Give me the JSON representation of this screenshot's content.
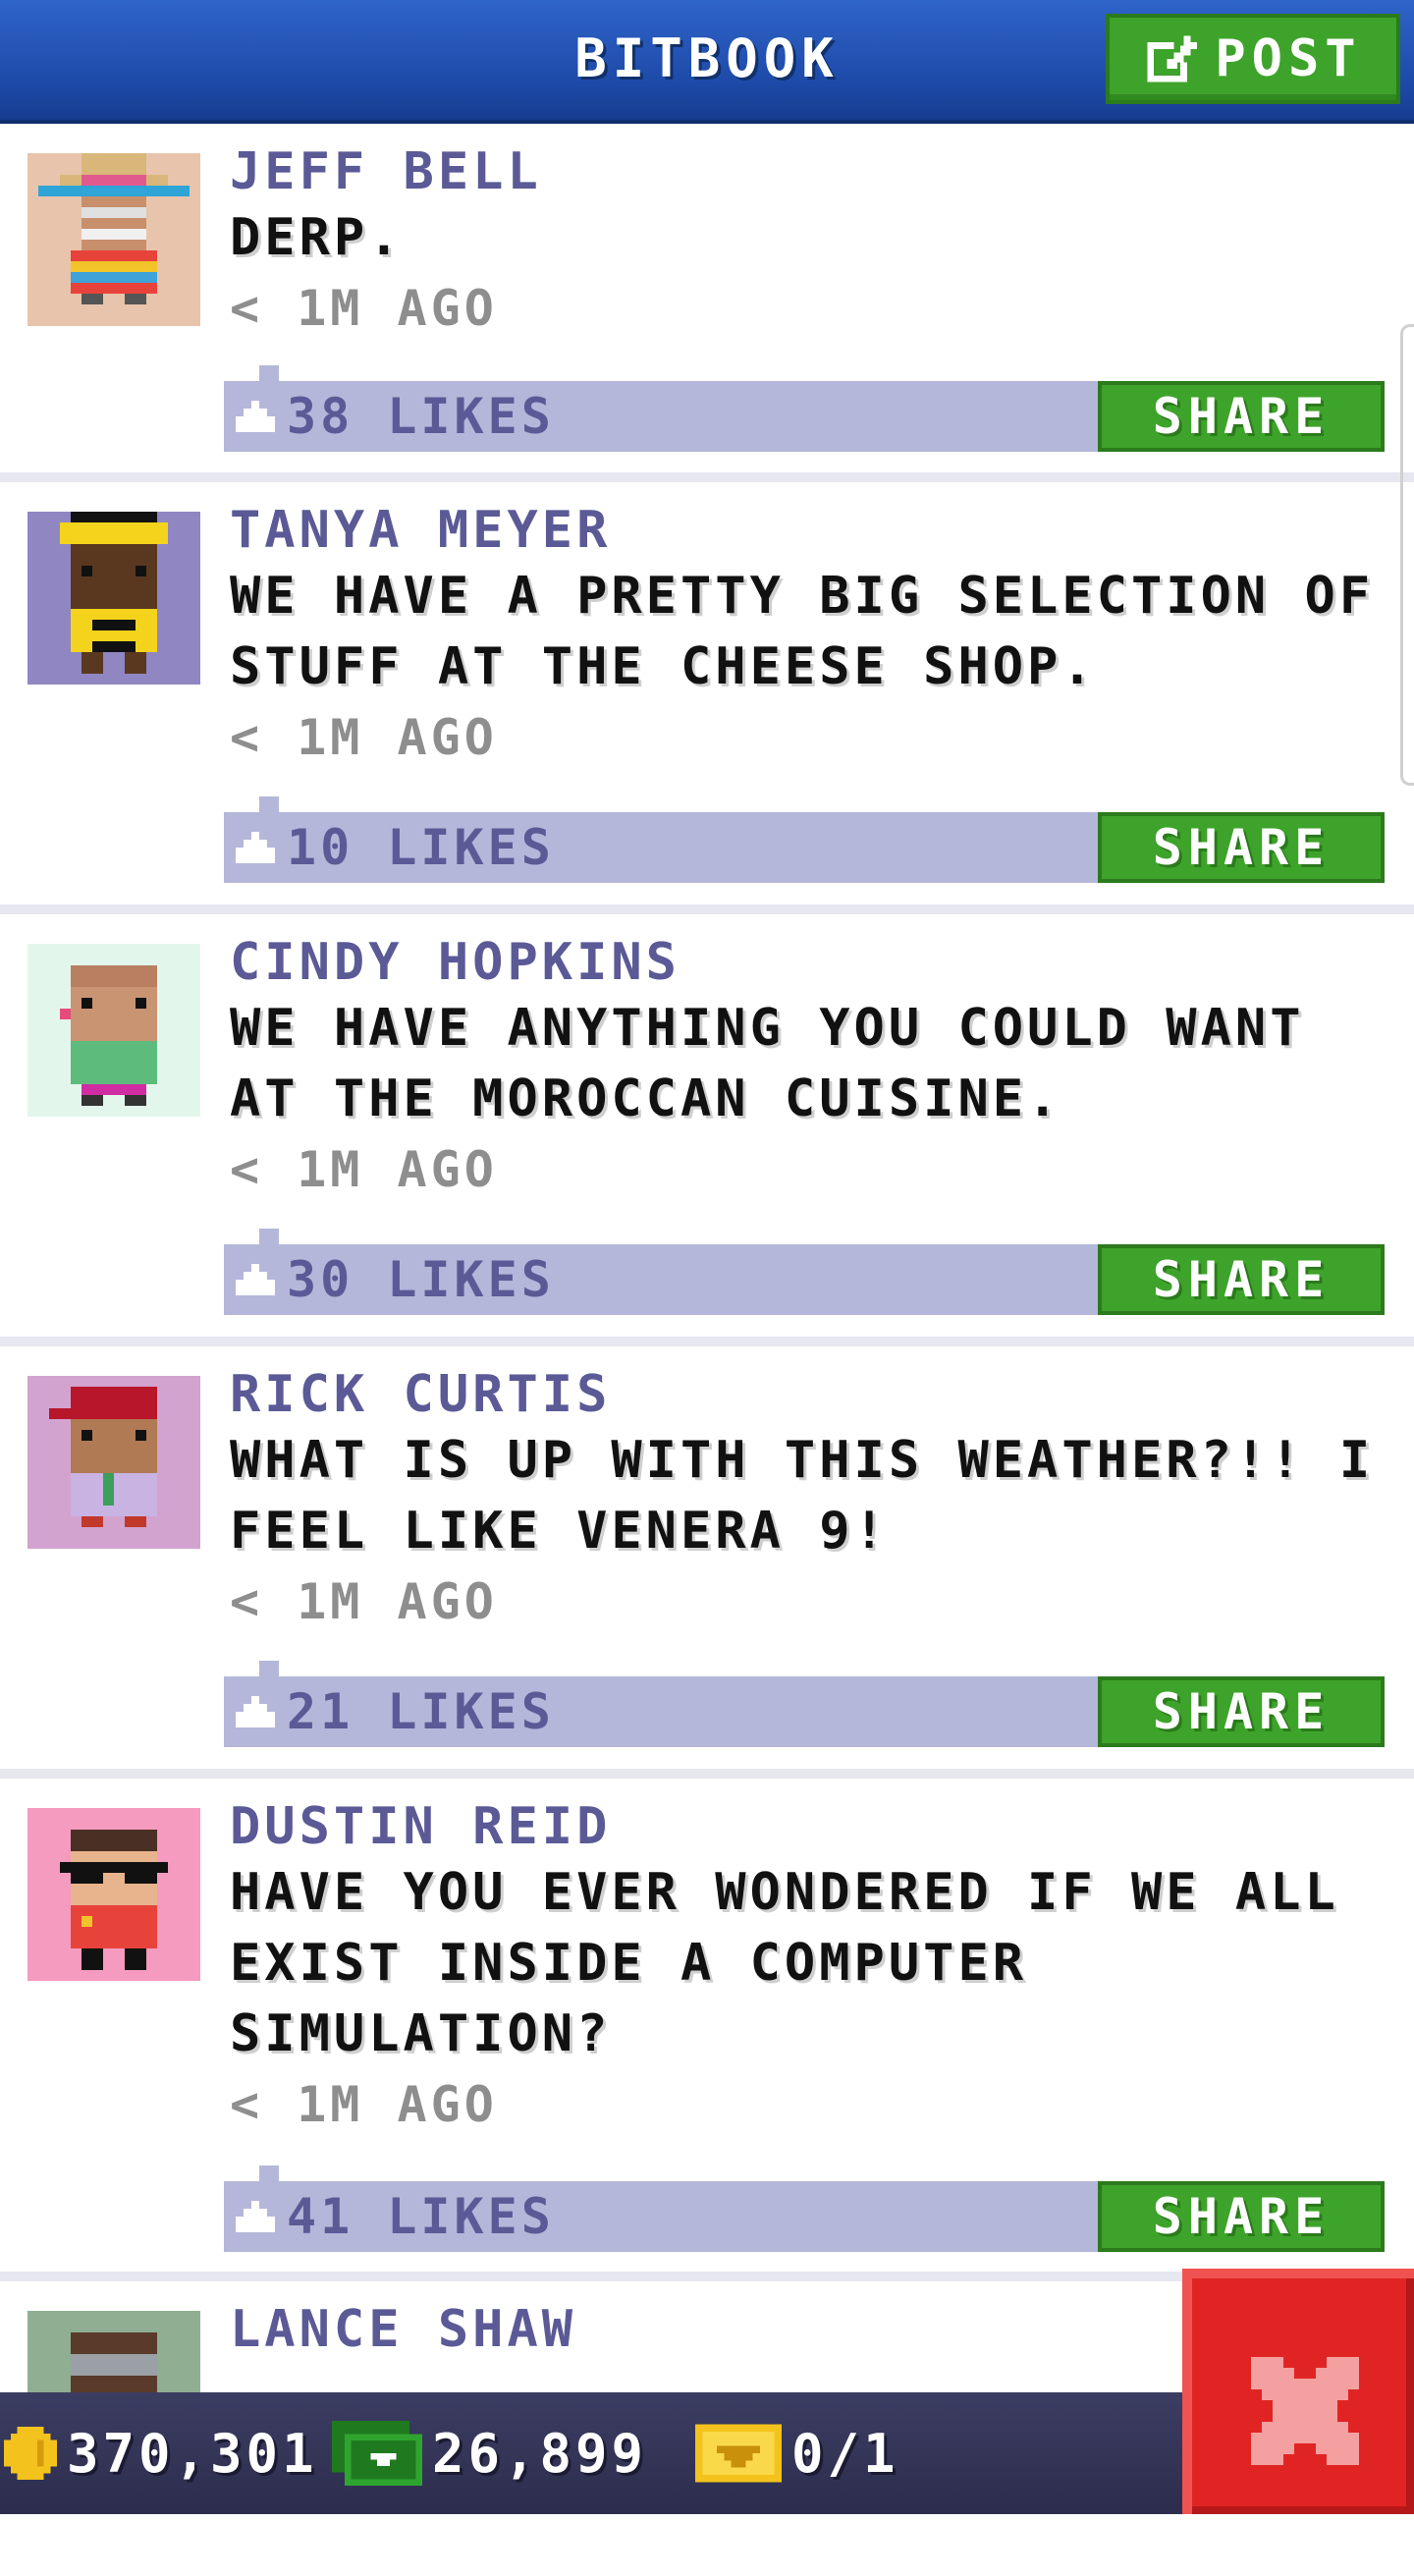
{
  "header": {
    "title": "BITBOOK",
    "post_label": "POST"
  },
  "posts": [
    {
      "author": "JEFF BELL",
      "message": "DERP.",
      "time": "< 1M AGO",
      "likes": "38 LIKES",
      "share": "SHARE",
      "avatar_bg": "#e8c4ac"
    },
    {
      "author": "TANYA MEYER",
      "message": "WE HAVE A PRETTY BIG SELECTION OF STUFF AT THE CHEESE SHOP.",
      "time": "< 1M AGO",
      "likes": "10 LIKES",
      "share": "SHARE",
      "avatar_bg": "#8f86c2"
    },
    {
      "author": "CINDY HOPKINS",
      "message": "WE HAVE ANYTHING YOU COULD WANT AT THE MOROCCAN CUISINE.",
      "time": "< 1M AGO",
      "likes": "30 LIKES",
      "share": "SHARE",
      "avatar_bg": "#e3f6ec"
    },
    {
      "author": "RICK CURTIS",
      "message": "WHAT IS UP WITH THIS WEATHER?!! I FEEL LIKE VENERA 9!",
      "time": "< 1M AGO",
      "likes": "21 LIKES",
      "share": "SHARE",
      "avatar_bg": "#d3a3d0"
    },
    {
      "author": "DUSTIN REID",
      "message": "HAVE YOU EVER WONDERED IF WE ALL EXIST INSIDE A COMPUTER SIMULATION?",
      "time": "< 1M AGO",
      "likes": "41 LIKES",
      "share": "SHARE",
      "avatar_bg": "#f49bbf"
    },
    {
      "author": "LANCE SHAW",
      "avatar_bg": "#8fae92"
    }
  ],
  "status": {
    "coins": "370,301",
    "bux": "26,899",
    "tickets": "0/1"
  },
  "colors": {
    "header": "#1d4aa8",
    "share_green": "#3ea32a",
    "bar": "#b4b7d9",
    "close_red": "#e02424"
  },
  "icons": [
    "edit-icon",
    "thumbs-up-icon",
    "coin-icon",
    "bux-icon",
    "ticket-icon",
    "close-icon"
  ]
}
